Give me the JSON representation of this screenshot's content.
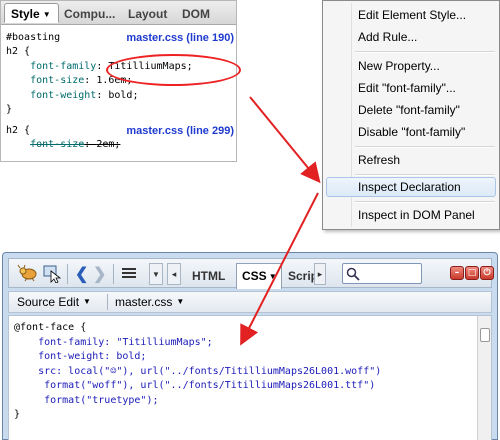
{
  "style_panel": {
    "tabs": [
      "Style",
      "Compu...",
      "Layout",
      "DOM"
    ],
    "rules": [
      {
        "selector_lines": [
          "#boasting",
          "h2 {"
        ],
        "source": "master.css (line 190)",
        "properties": [
          {
            "name": "font-family",
            "value": "TitilliumMaps;"
          },
          {
            "name": "font-size",
            "value": "1.6em;"
          },
          {
            "name": "font-weight",
            "value": "bold;"
          }
        ],
        "close": "}"
      },
      {
        "selector_lines": [
          "h2 {"
        ],
        "source": "master.css (line 299)",
        "properties": [
          {
            "name": "font-size",
            "value": "2em;"
          }
        ]
      }
    ]
  },
  "context_menu": {
    "items": [
      "Edit Element Style...",
      "Add Rule...",
      "New Property...",
      "Edit \"font-family\"...",
      "Delete \"font-family\"",
      "Disable \"font-family\"",
      "Refresh",
      "Inspect Declaration",
      "Inspect in DOM Panel"
    ],
    "highlighted": "Inspect Declaration"
  },
  "firebug": {
    "tabs": [
      "HTML",
      "CSS",
      "Scrip"
    ],
    "active_tab": "CSS",
    "search_placeholder": "",
    "subbar": {
      "edit_label": "Source Edit",
      "file_label": "master.css"
    },
    "code_lines": [
      "@font-face {",
      "    font-family: \"TitilliumMaps\";",
      "    font-weight: bold;",
      "    src: local(\"☺\"), url(\"../fonts/TitilliumMaps26L001.woff\")",
      "     format(\"woff\"), url(\"../fonts/TitilliumMaps26L001.ttf\")",
      "     format(\"truetype\");",
      "}"
    ]
  },
  "colors": {
    "annotation": "#e22222",
    "link": "#1f3bcf",
    "highlight": "#dce9f7"
  }
}
